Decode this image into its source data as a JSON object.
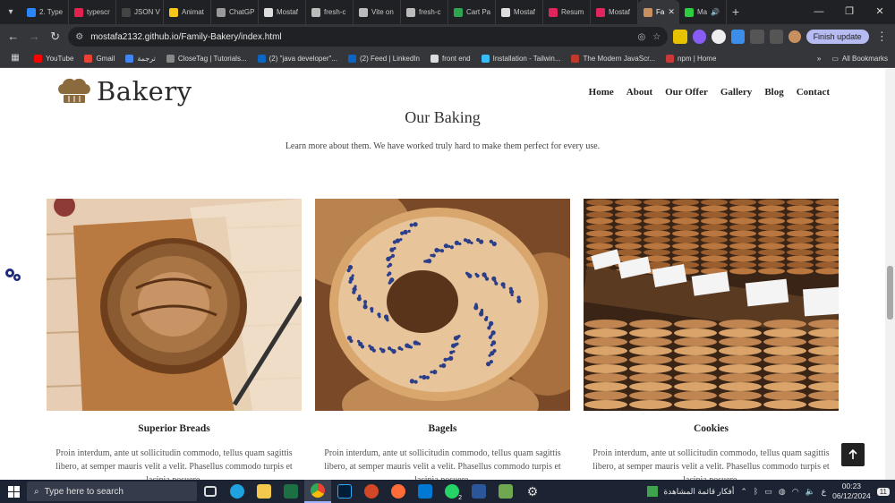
{
  "browser": {
    "tabs": [
      {
        "title": "2. Type",
        "color": "#2a86ff"
      },
      {
        "title": "typescr",
        "color": "#e0234e"
      },
      {
        "title": "JSON V",
        "color": "#444"
      },
      {
        "title": "Animat",
        "color": "#f5c518"
      },
      {
        "title": "ChatGP",
        "color": "#999"
      },
      {
        "title": "Mostaf",
        "color": "#ddd"
      },
      {
        "title": "fresh-c",
        "color": "#bbb"
      },
      {
        "title": "Vite on",
        "color": "#bbb"
      },
      {
        "title": "fresh-c",
        "color": "#bbb"
      },
      {
        "title": "Cart Pa",
        "color": "#2ea44f"
      },
      {
        "title": "Mostaf",
        "color": "#ddd"
      },
      {
        "title": "Resum",
        "color": "#e0245e"
      },
      {
        "title": "Mostaf",
        "color": "#e0245e"
      }
    ],
    "active_tab": {
      "title": "Fa",
      "close": "✕"
    },
    "extra_tab": {
      "title": "Ma",
      "color": "#2ecc40"
    },
    "new_tab": "+",
    "url": "mostafa2132.github.io/Family-Bakery/index.html",
    "finish_update": "Finish update",
    "bookmarks": [
      {
        "label": "YouTube",
        "color": "#ff0000"
      },
      {
        "label": "Gmail",
        "color": "#ea4335"
      },
      {
        "label": "ترجمة",
        "color": "#4285f4"
      },
      {
        "label": "CloseTag | Tutorials...",
        "color": "#888"
      },
      {
        "label": "(2) \"java developer\"...",
        "color": "#0a66c2"
      },
      {
        "label": "(2) Feed | LinkedIn",
        "color": "#0a66c2"
      },
      {
        "label": "front end",
        "color": "#ddd"
      },
      {
        "label": "Installation - Tailwin...",
        "color": "#38bdf8"
      },
      {
        "label": "The Modern JavaScr...",
        "color": "#c0392b"
      },
      {
        "label": "npm | Home",
        "color": "#cb3837"
      }
    ],
    "bookmarks_more": "»",
    "all_bookmarks": "All Bookmarks"
  },
  "site": {
    "brand": "Bakery",
    "nav": [
      "Home",
      "About",
      "Our Offer",
      "Gallery",
      "Blog",
      "Contact"
    ],
    "section_title": "Our Baking",
    "section_subtitle": "Learn more about them. We have worked truly hard to make them perfect for every use.",
    "cards": [
      {
        "name": "Superior Breads",
        "desc": "Proin interdum, ante ut sollicitudin commodo, tellus quam sagittis libero, at semper mauris velit a velit. Phasellus commodo turpis et lacinia posuere."
      },
      {
        "name": "Bagels",
        "desc": "Proin interdum, ante ut sollicitudin commodo, tellus quam sagittis libero, at semper mauris velit a velit. Phasellus commodo turpis et lacinia posuere."
      },
      {
        "name": "Cookies",
        "desc": "Proin interdum, ante ut sollicitudin commodo, tellus quam sagittis libero, at semper mauris velit a velit. Phasellus commodo turpis et lacinia posuere."
      }
    ]
  },
  "taskbar": {
    "search_placeholder": "Type here to search",
    "news": "أفكار قائمة المشاهدة",
    "time": "00:23",
    "date": "06/12/2024",
    "lang": "ع",
    "notifications": "11",
    "whatsapp_badge": "2"
  }
}
